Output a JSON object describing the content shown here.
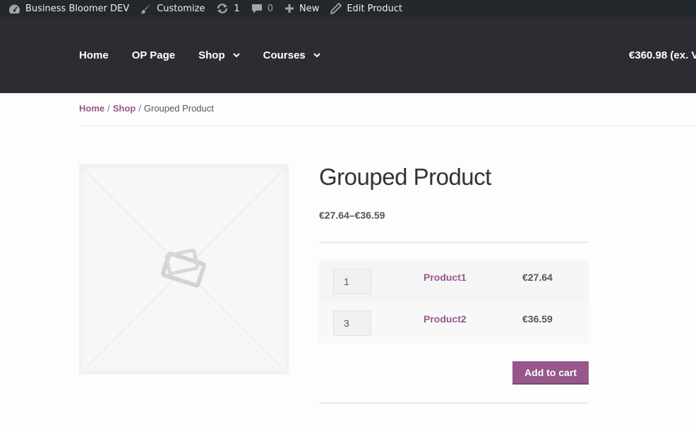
{
  "admin_bar": {
    "site_name": "Business Bloomer DEV",
    "customize": "Customize",
    "updates_count": "1",
    "comments_count": "0",
    "new": "New",
    "edit_product": "Edit Product"
  },
  "nav": {
    "items": [
      {
        "label": "Home",
        "dropdown": false
      },
      {
        "label": "OP Page",
        "dropdown": false
      },
      {
        "label": "Shop",
        "dropdown": true
      },
      {
        "label": "Courses",
        "dropdown": true
      }
    ],
    "cart_total": "€360.98 (ex. V"
  },
  "breadcrumb": {
    "home": "Home",
    "sep": "/",
    "shop": "Shop",
    "current": "Grouped Product"
  },
  "product": {
    "title": "Grouped Product",
    "price_range": "€27.64–€36.59",
    "grouped_items": [
      {
        "quantity": "1",
        "name": "Product1",
        "price": "€27.64"
      },
      {
        "quantity": "3",
        "name": "Product2",
        "price": "€36.59"
      }
    ],
    "add_to_cart_label": "Add to cart"
  },
  "colors": {
    "admin_bar_bg": "#23282d",
    "header_bg": "#2c2d33",
    "accent": "#96588a"
  }
}
